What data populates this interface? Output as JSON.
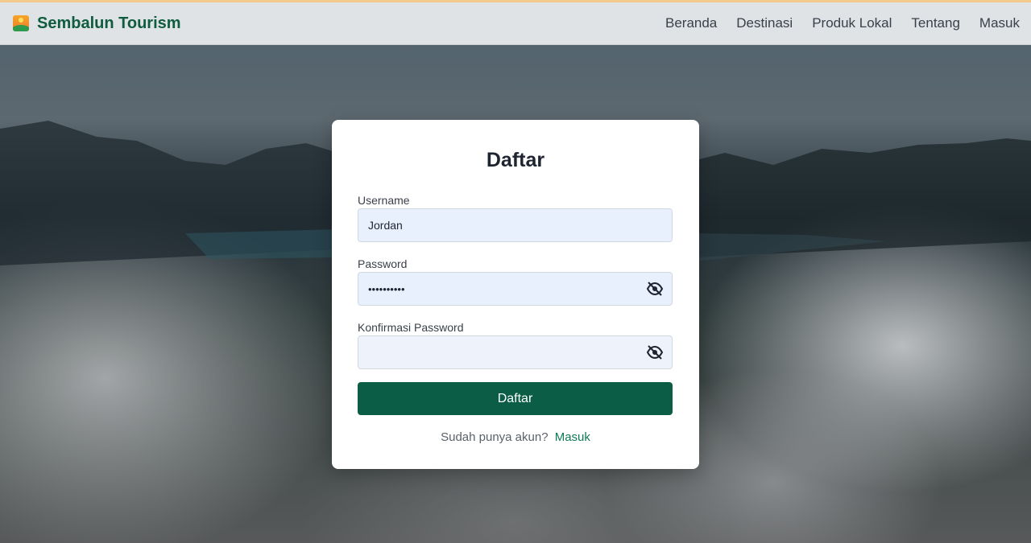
{
  "brand": {
    "name": "Sembalun Tourism",
    "logo_icon": "mountain-sunset-icon"
  },
  "nav": {
    "items": [
      {
        "label": "Beranda"
      },
      {
        "label": "Destinasi"
      },
      {
        "label": "Produk Lokal"
      },
      {
        "label": "Tentang"
      },
      {
        "label": "Masuk"
      }
    ]
  },
  "form": {
    "title": "Daftar",
    "username": {
      "label": "Username",
      "value": "Jordan"
    },
    "password": {
      "label": "Password",
      "value": "••••••••••",
      "toggle_icon": "eye-slash-icon"
    },
    "confirm_password": {
      "label": "Konfirmasi Password",
      "value": "",
      "toggle_icon": "eye-slash-icon"
    },
    "submit_label": "Daftar",
    "footer_text": "Sudah punya akun?",
    "footer_link": "Masuk"
  },
  "colors": {
    "brand": "#0f5c3e",
    "primary_button": "#0b5e45",
    "link": "#0f7a57",
    "accent_top_line": "#f3c98b"
  }
}
